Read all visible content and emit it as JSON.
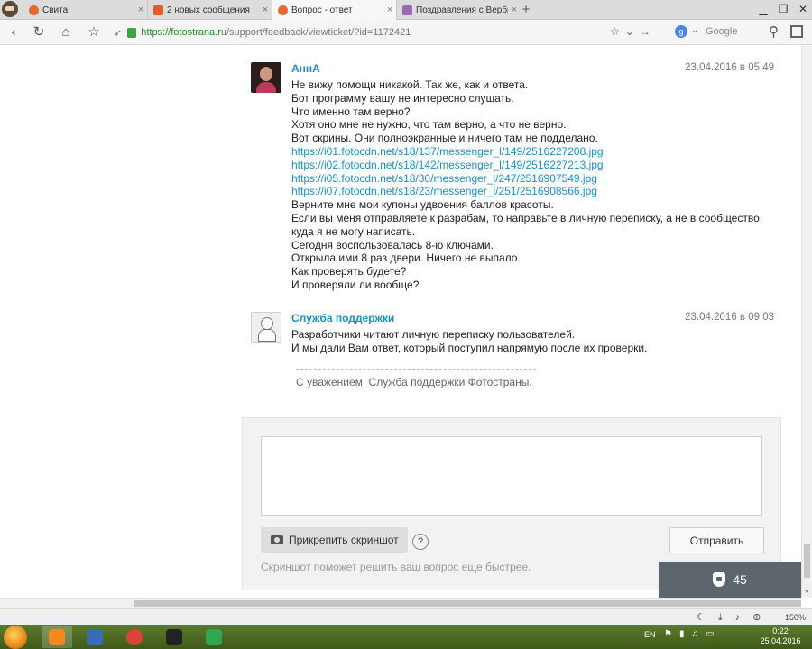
{
  "browser": {
    "tabs": [
      {
        "title": "Свита",
        "active": false
      },
      {
        "title": "2 новых сообщения",
        "active": false
      },
      {
        "title": "Вопрос - ответ",
        "active": true
      },
      {
        "title": "Поздравления с Вербны",
        "active": false
      }
    ],
    "tab_close_glyph": "×",
    "new_tab_glyph": "+",
    "url": {
      "domain": "https://fotostrana.ru",
      "path": "/support/feedback/viewticket/?id=1172421"
    },
    "search_placeholder": "Google",
    "search_engine_letter": "g"
  },
  "ticket": {
    "messages": [
      {
        "author": "АннА",
        "date": "23.04.2016 в 05:49",
        "avatar": "user-photo",
        "lines": [
          {
            "text": "Не вижу помощи никакой. Так же, как и ответа.",
            "link": false
          },
          {
            "text": "Бот программу вашу не интересно слушать.",
            "link": false
          },
          {
            "text": "Что именно там верно?",
            "link": false
          },
          {
            "text": "Хотя оно мне не нужно, что там верно, а что не верно.",
            "link": false
          },
          {
            "text": "Вот скрины. Они полноэкранные и ничего там не подделано.",
            "link": false
          },
          {
            "text": "https://i01.fotocdn.net/s18/137/messenger_l/149/2516227208.jpg",
            "link": true
          },
          {
            "text": "https://i02.fotocdn.net/s18/142/messenger_l/149/2516227213.jpg",
            "link": true
          },
          {
            "text": "https://i05.fotocdn.net/s18/30/messenger_l/247/2516907549.jpg",
            "link": true
          },
          {
            "text": "https://i07.fotocdn.net/s18/23/messenger_l/251/2516908566.jpg",
            "link": true
          },
          {
            "text": "Верните мне мои купоны удвоения баллов красоты.",
            "link": false
          },
          {
            "text": "Если вы меня отправляете к разрабам, то направьте в личную переписку, а не в сообщество,",
            "link": false
          },
          {
            "text": "куда я не могу написать.",
            "link": false
          },
          {
            "text": "Сегодня воспользовалась 8-ю ключами.",
            "link": false
          },
          {
            "text": "Открыла ими 8 раз двери. Ничего не выпало.",
            "link": false
          },
          {
            "text": "Как проверять будете?",
            "link": false
          },
          {
            "text": "И проверяли ли вообще?",
            "link": false
          }
        ]
      },
      {
        "author": "Служба поддержки",
        "date": "23.04.2016 в 09:03",
        "avatar": "support-icon",
        "lines": [
          {
            "text": "Разработчики читают личную переписку пользователей.",
            "link": false
          },
          {
            "text": "И мы дали Вам ответ, который поступил напрямую после их проверки.",
            "link": false
          }
        ]
      }
    ],
    "signature": "С уважением, Служба поддержки Фотостраны."
  },
  "reply": {
    "text_value": "",
    "attach_label": "Прикрепить скриншот",
    "help_glyph": "?",
    "send_label": "Отправить",
    "hint": "Скриншот поможет решить ваш вопрос еще быстрее."
  },
  "badge": {
    "icon": "shield-icon",
    "count": "45"
  },
  "statusbar": {
    "zoom": "150%"
  },
  "taskbar": {
    "lang": "EN",
    "time": "0:22",
    "date": "25.04.2016",
    "apps": [
      {
        "name": "browser-app",
        "color": "#f08a1c"
      },
      {
        "name": "screenshot-app",
        "color": "#3a6bb5"
      },
      {
        "name": "chrome-app",
        "color": "#db4437"
      },
      {
        "name": "paint-app",
        "color": "#222222"
      },
      {
        "name": "green-app",
        "color": "#2fa84f"
      }
    ]
  },
  "colors": {
    "link": "#1b8fc7",
    "author": "#1b8fc7",
    "badge_bg": "#5e666d"
  }
}
